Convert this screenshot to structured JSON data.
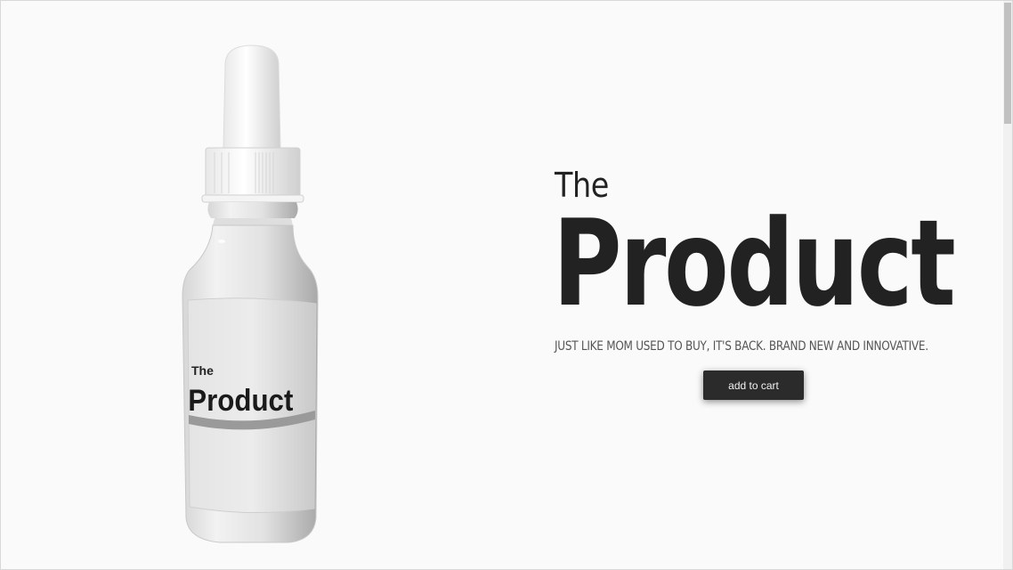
{
  "product": {
    "label_small": "The",
    "label_large": "Product"
  },
  "hero": {
    "eyebrow": "The",
    "title": "Product",
    "tagline": "JUST LIKE MOM USED TO BUY, IT'S BACK. BRAND NEW AND INNOVATIVE."
  },
  "cart": {
    "button_label": "add to cart"
  },
  "colors": {
    "background": "#fafafa",
    "text": "#222222",
    "button": "#2b2b2b"
  }
}
